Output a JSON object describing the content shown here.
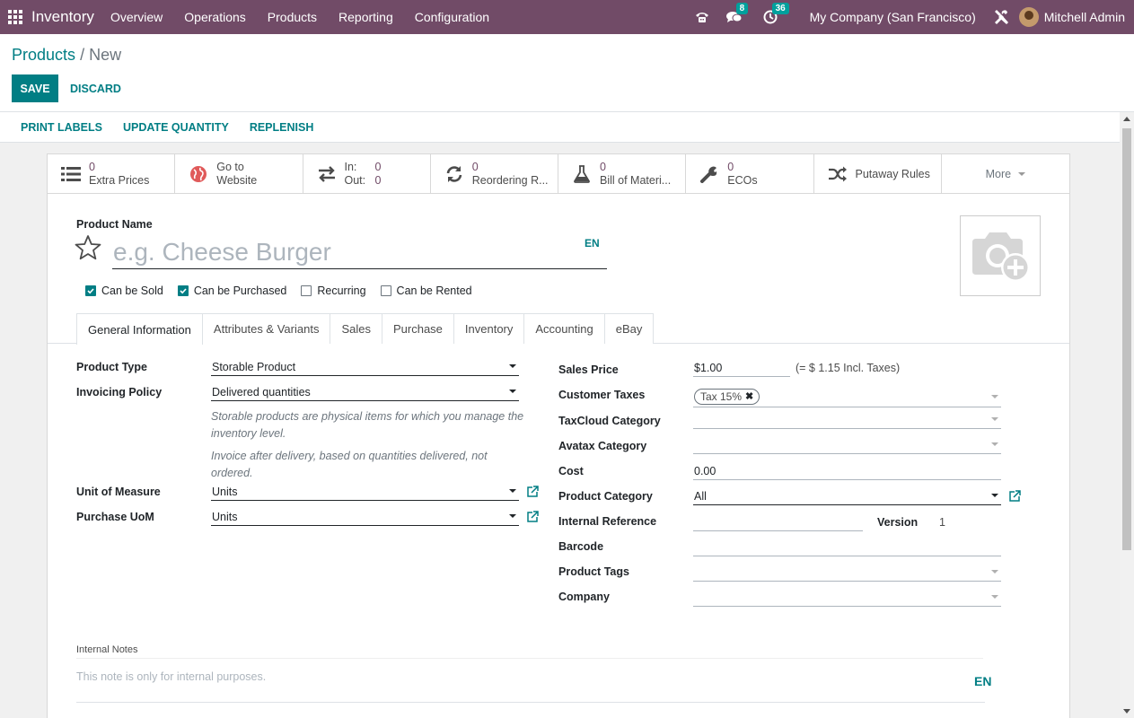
{
  "navbar": {
    "brand": "Inventory",
    "menu": [
      "Overview",
      "Operations",
      "Products",
      "Reporting",
      "Configuration"
    ],
    "messages_count": "8",
    "activities_count": "36",
    "company": "My Company (San Francisco)",
    "user": "Mitchell Admin"
  },
  "breadcrumb": {
    "parent": "Products",
    "separator": "/",
    "current": "New"
  },
  "buttons": {
    "save": "SAVE",
    "discard": "DISCARD"
  },
  "statusbar": {
    "print_labels": "PRINT LABELS",
    "update_quantity": "UPDATE QUANTITY",
    "replenish": "REPLENISH"
  },
  "smart_buttons": {
    "extra_prices": {
      "value": "0",
      "label": "Extra Prices"
    },
    "website": {
      "line1": "Go to",
      "line2": "Website"
    },
    "inout": {
      "in_label": "In:",
      "in_value": "0",
      "out_label": "Out:",
      "out_value": "0"
    },
    "reordering": {
      "value": "0",
      "label": "Reordering R..."
    },
    "bom": {
      "value": "0",
      "label": "Bill of Materi..."
    },
    "ecos": {
      "value": "0",
      "label": "ECOs"
    },
    "putaway": {
      "label": "Putaway Rules"
    },
    "more": {
      "label": "More"
    }
  },
  "product": {
    "name_label": "Product Name",
    "name_placeholder": "e.g. Cheese Burger",
    "lang": "EN"
  },
  "checkboxes": [
    {
      "label": "Can be Sold",
      "checked": true
    },
    {
      "label": "Can be Purchased",
      "checked": true
    },
    {
      "label": "Recurring",
      "checked": false
    },
    {
      "label": "Can be Rented",
      "checked": false
    }
  ],
  "tabs": [
    "General Information",
    "Attributes & Variants",
    "Sales",
    "Purchase",
    "Inventory",
    "Accounting",
    "eBay"
  ],
  "left_fields": {
    "product_type_label": "Product Type",
    "product_type": "Storable Product",
    "invoicing_policy_label": "Invoicing Policy",
    "invoicing_policy": "Delivered quantities",
    "help_storable": "Storable products are physical items for which you manage the inventory level.",
    "help_invoice": "Invoice after delivery, based on quantities delivered, not ordered.",
    "uom_label": "Unit of Measure",
    "uom": "Units",
    "purchase_uom_label": "Purchase UoM",
    "purchase_uom": "Units"
  },
  "right_fields": {
    "sales_price_label": "Sales Price",
    "sales_price": "$1.00",
    "incl_taxes": "(= $ 1.15 Incl. Taxes)",
    "customer_taxes_label": "Customer Taxes",
    "tax_tag": "Tax 15%",
    "taxcloud_label": "TaxCloud Category",
    "avatax_label": "Avatax Category",
    "cost_label": "Cost",
    "cost": "0.00",
    "product_category_label": "Product Category",
    "product_category": "All",
    "internal_ref_label": "Internal Reference",
    "version_label": "Version",
    "version": "1",
    "barcode_label": "Barcode",
    "product_tags_label": "Product Tags",
    "company_label": "Company"
  },
  "notes": {
    "label": "Internal Notes",
    "placeholder": "This note is only for internal purposes.",
    "lang": "EN"
  },
  "colors": {
    "navbar": "#714b67",
    "primary": "#017e84",
    "smart_value": "#714b67"
  },
  "icons": [
    "apps-grid-icon",
    "phone-icon",
    "chat-icon",
    "clock-icon",
    "tools-icon",
    "list-icon",
    "globe-icon",
    "transfer-icon",
    "refresh-icon",
    "flask-icon",
    "wrench-icon",
    "shuffle-icon",
    "star-icon",
    "camera-plus-icon",
    "external-link-icon"
  ]
}
